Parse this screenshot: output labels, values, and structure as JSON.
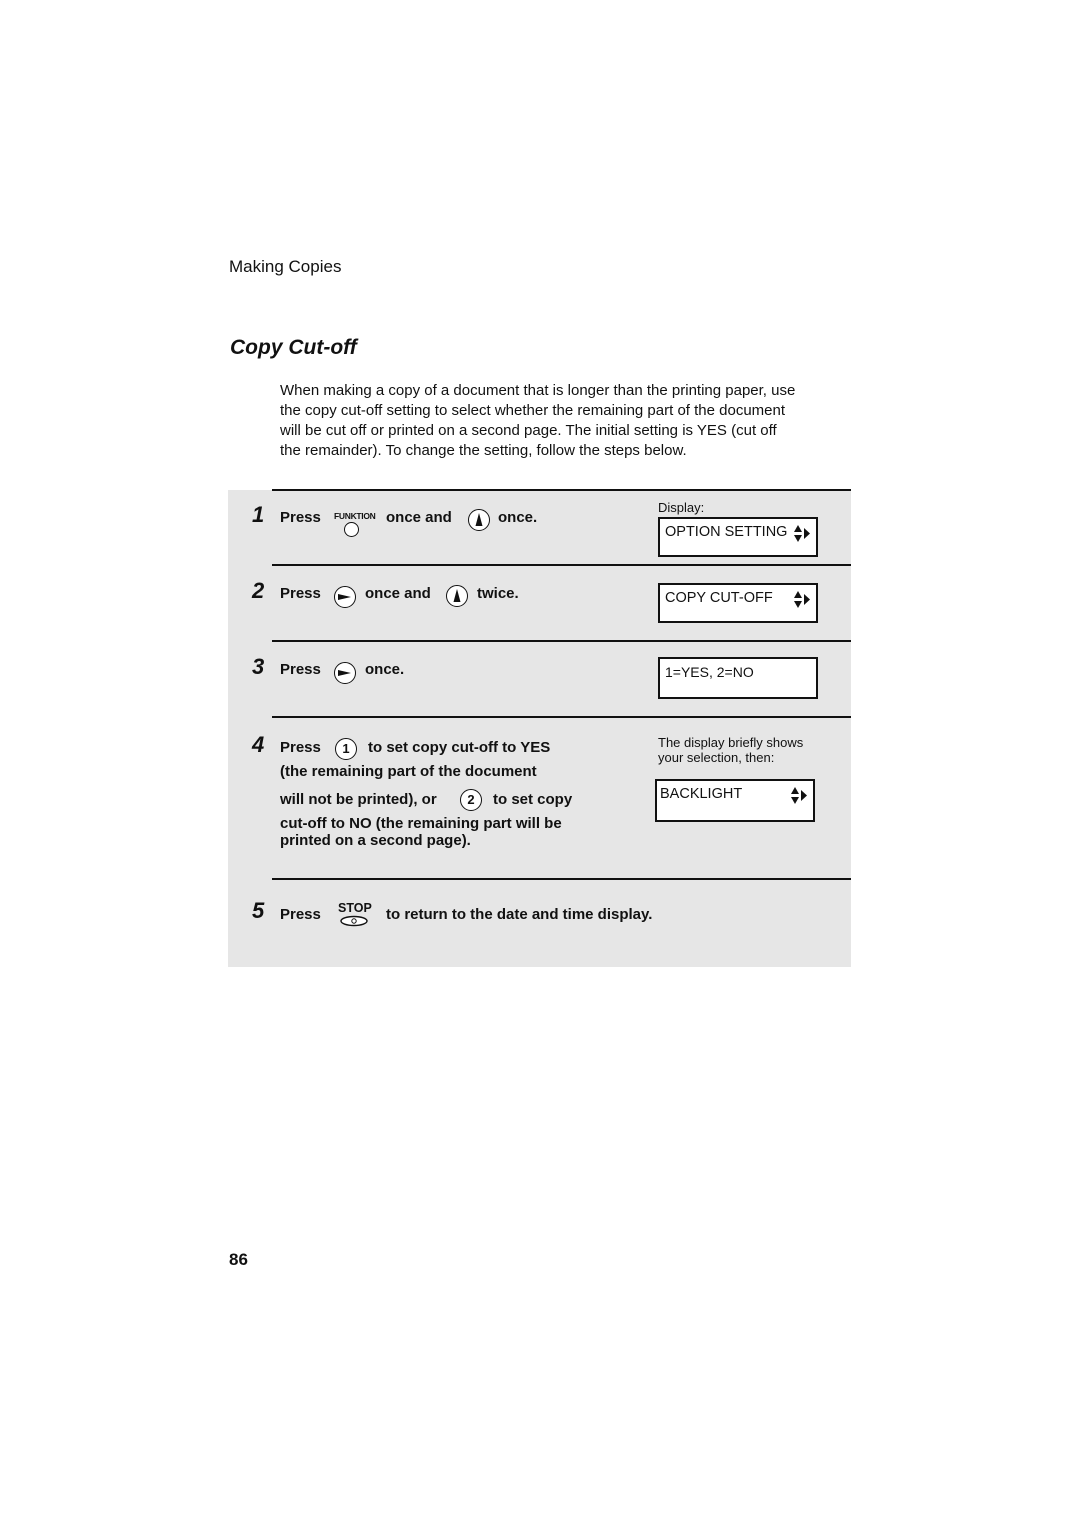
{
  "header": {
    "section": "Making Copies"
  },
  "title": "Copy Cut-off",
  "intro": {
    "lines": [
      "When making a copy of a document that is longer than the printing paper, use",
      "the copy cut-off setting to select whether the remaining part of the document",
      "will be cut off or printed on a second page. The initial setting is YES (cut off",
      "the remainder). To change the setting, follow the steps below."
    ]
  },
  "steps": [
    {
      "number": "1",
      "press": "Press",
      "key1_label": "FUNKTION",
      "mid": "once and",
      "end": "once.",
      "display_label": "Display:",
      "display_text": "OPTION SETTING"
    },
    {
      "number": "2",
      "press": "Press",
      "mid": "once and",
      "end": "twice.",
      "display_text": "COPY CUT-OFF"
    },
    {
      "number": "3",
      "press": "Press",
      "end": "once.",
      "display_text": "1=YES, 2=NO"
    },
    {
      "number": "4",
      "press": "Press",
      "key1": "1",
      "line1_rest": "to set copy cut-off to YES",
      "line2": "(the remaining part of the document",
      "line3_start": "will not be printed), or",
      "key2": "2",
      "line3_end": "to set copy",
      "line4": "cut-off to NO (the remaining part will be",
      "line5": "printed on a second page).",
      "display_note_line1": "The display briefly shows",
      "display_note_line2": "your selection, then:",
      "display_text": "BACKLIGHT"
    },
    {
      "number": "5",
      "press": "Press",
      "key_label": "STOP",
      "end": "to return to the date and time display."
    }
  ],
  "page_number": "86"
}
